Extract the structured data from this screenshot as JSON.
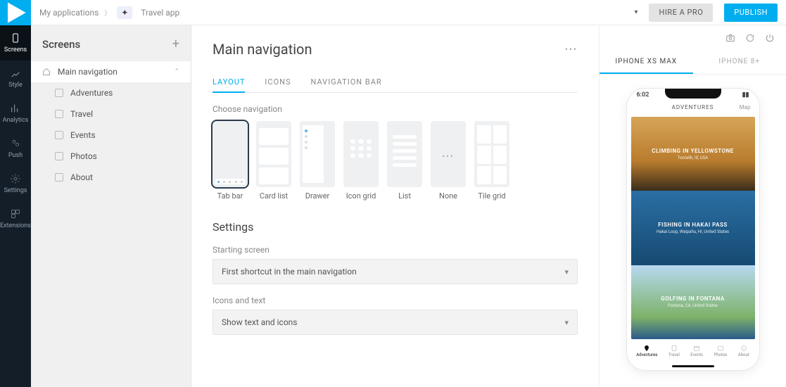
{
  "breadcrumb": {
    "root": "My applications",
    "app": "Travel app"
  },
  "topbar": {
    "hire": "HIRE A PRO",
    "publish": "PUBLISH"
  },
  "iconbar": [
    {
      "label": "Screens"
    },
    {
      "label": "Style"
    },
    {
      "label": "Analytics"
    },
    {
      "label": "Push"
    },
    {
      "label": "Settings"
    },
    {
      "label": "Extensions"
    }
  ],
  "sidebar": {
    "title": "Screens",
    "items": [
      {
        "label": "Main navigation",
        "active": true
      },
      {
        "label": "Adventures"
      },
      {
        "label": "Travel"
      },
      {
        "label": "Events"
      },
      {
        "label": "Photos"
      },
      {
        "label": "About"
      }
    ]
  },
  "content": {
    "title": "Main navigation",
    "tabs": [
      "LAYOUT",
      "ICONS",
      "NAVIGATION BAR"
    ],
    "choose_label": "Choose navigation",
    "nav_options": [
      "Tab bar",
      "Card list",
      "Drawer",
      "Icon grid",
      "List",
      "None",
      "Tile grid"
    ],
    "settings_title": "Settings",
    "starting_label": "Starting screen",
    "starting_value": "First shortcut in the main navigation",
    "icons_label": "Icons and text",
    "icons_value": "Show text and icons"
  },
  "preview": {
    "tabs": [
      "IPHONE XS MAX",
      "IPHONE 8+"
    ],
    "time": "6:02",
    "header": "ADVENTURES",
    "header_right": "Map",
    "cards": [
      {
        "title": "CLIMBING IN YELLOWSTONE",
        "sub": "Tootalik, ID, USA"
      },
      {
        "title": "FISHING IN HAKAI PASS",
        "sub": "Hakai Loop, Waipahu, HI, United States"
      },
      {
        "title": "GOLFING IN FONTANA",
        "sub": "Fontana, CA, United States"
      }
    ],
    "tabbar": [
      "Adventures",
      "Travel",
      "Events",
      "Photos",
      "About"
    ]
  }
}
